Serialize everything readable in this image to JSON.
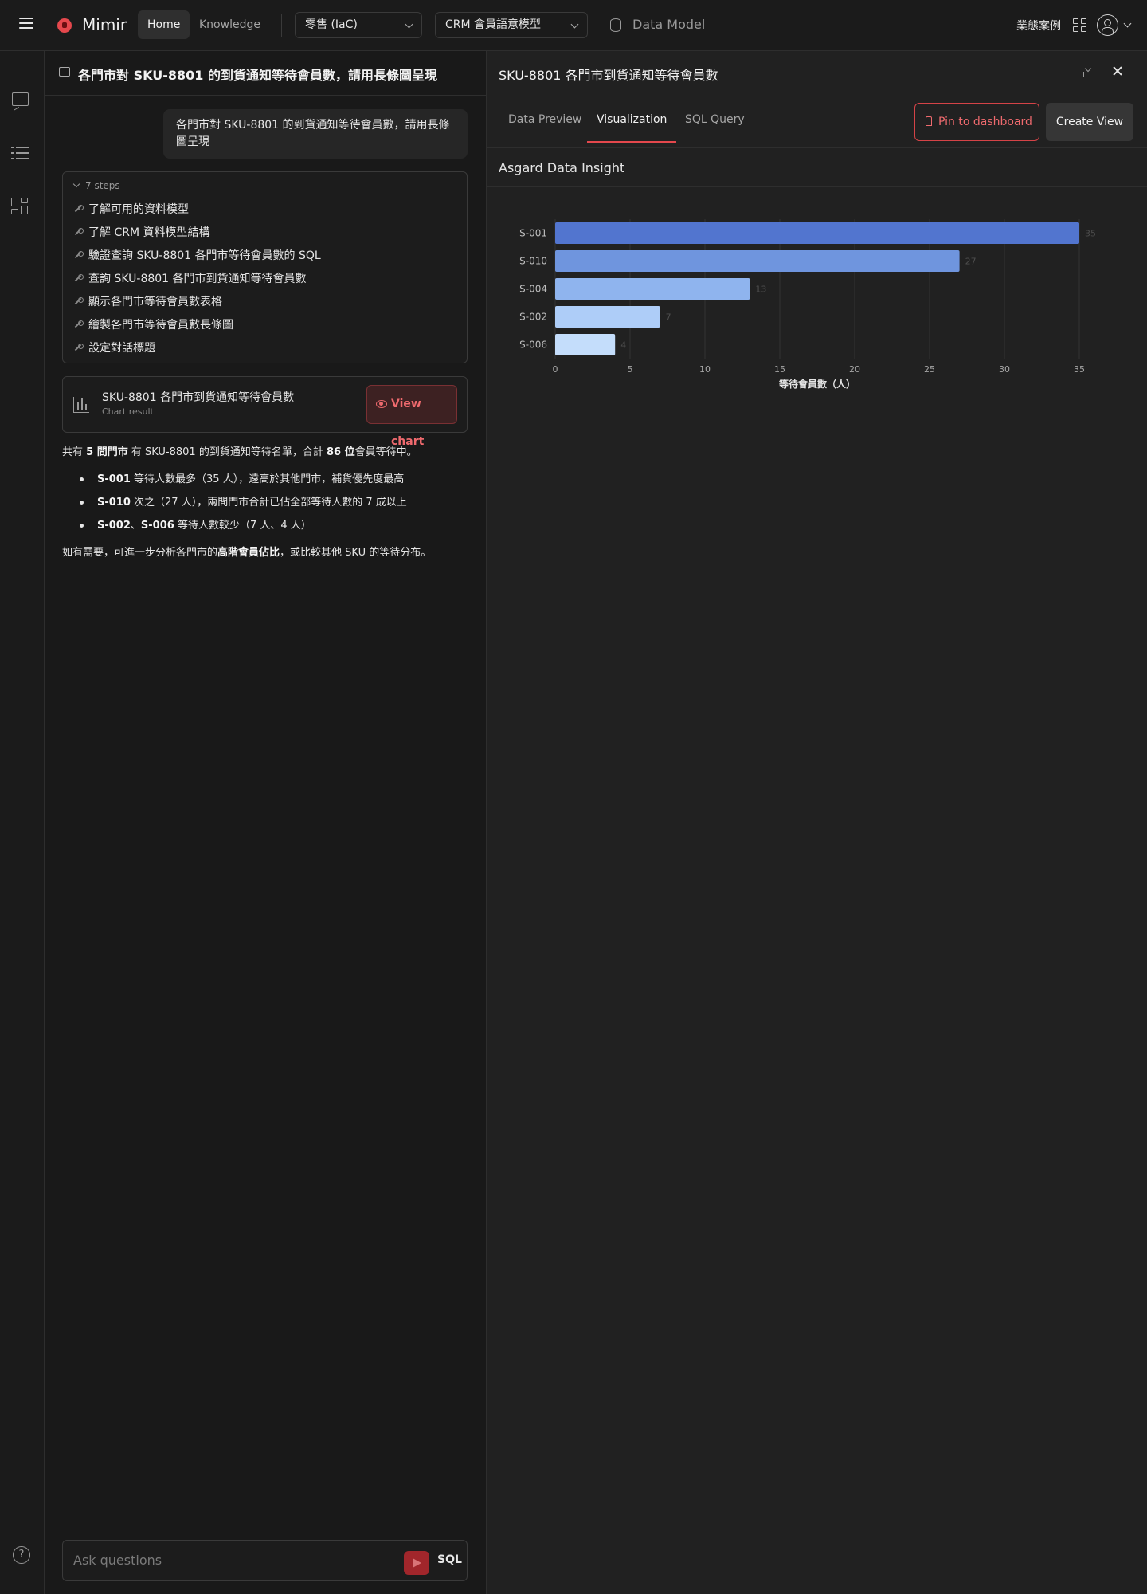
{
  "topbar": {
    "brand": "Mimir",
    "nav_home": "Home",
    "nav_knowledge": "Knowledge",
    "project_select": "零售 (IaC)",
    "model_select": "CRM 會員語意模型",
    "data_model": "Data Model",
    "cases": "業態案例"
  },
  "chat": {
    "title": "各門市對 SKU-8801 的到貨通知等待會員數，請用長條圖呈現",
    "user_message": "各門市對 SKU-8801 的到貨通知等待會員數，請用長條圖呈現",
    "steps_label": "7 steps",
    "steps": [
      "了解可用的資料模型",
      "了解 CRM 資料模型結構",
      "驗證查詢 SKU-8801 各門市等待會員數的 SQL",
      "查詢 SKU-8801 各門市到貨通知等待會員數",
      "顯示各門市等待會員數表格",
      "繪製各門市等待會員數長條圖",
      "設定對話標題"
    ],
    "chart_card": {
      "title": "SKU-8801 各門市到貨通知等待會員數",
      "subtitle": "Chart result",
      "button": "View chart"
    },
    "answer": {
      "p1_a": "共有 ",
      "p1_b": "5 間門市",
      "p1_c": " 有 SKU-8801 的到貨通知等待名單，合計 ",
      "p1_d": "86 位",
      "p1_e": "會員等待中。",
      "b1_bold": "S-001",
      "b1_text": " 等待人數最多（35 人），遠高於其他門市，補貨優先度最高",
      "b2_bold": "S-010",
      "b2_text": " 次之（27 人），兩間門市合計已佔全部等待人數的 7 成以上",
      "b3_bold1": "S-002",
      "b3_sep": "、",
      "b3_bold2": "S-006",
      "b3_text": " 等待人數較少（7 人、4 人）",
      "p2_a": "如有需要，可進一步分析各門市的",
      "p2_b": "高階會員佔比",
      "p2_c": "，或比較其他 SKU 的等待分布。"
    },
    "composer_placeholder": "Ask questions",
    "composer_mode": "SQL"
  },
  "viz": {
    "title": "SKU-8801 各門市到貨通知等待會員數",
    "tabs": [
      "Data Preview",
      "Visualization",
      "SQL Query"
    ],
    "active_tab": "Visualization",
    "pin_button": "Pin to dashboard",
    "create_button": "Create View",
    "insight_title": "Asgard Data Insight"
  },
  "chart_data": {
    "type": "bar",
    "orientation": "horizontal",
    "categories": [
      "S-001",
      "S-010",
      "S-004",
      "S-002",
      "S-006"
    ],
    "values": [
      35,
      27,
      13,
      7,
      4
    ],
    "data_labels": [
      "35",
      "27",
      "13",
      "7",
      "4"
    ],
    "colors": [
      "#5275cf",
      "#6f95de",
      "#8fb4ee",
      "#aecdf8",
      "#c4ddfb"
    ],
    "xlabel": "等待會員數（人）",
    "ylabel": "",
    "xlim": [
      0,
      35
    ],
    "xticks": [
      "0",
      "5",
      "10",
      "15",
      "20",
      "25",
      "30",
      "35"
    ],
    "grid": true,
    "legend": "none"
  },
  "colors": {
    "accent": "#e5484d",
    "background": "#191919",
    "panel": "#212121"
  }
}
